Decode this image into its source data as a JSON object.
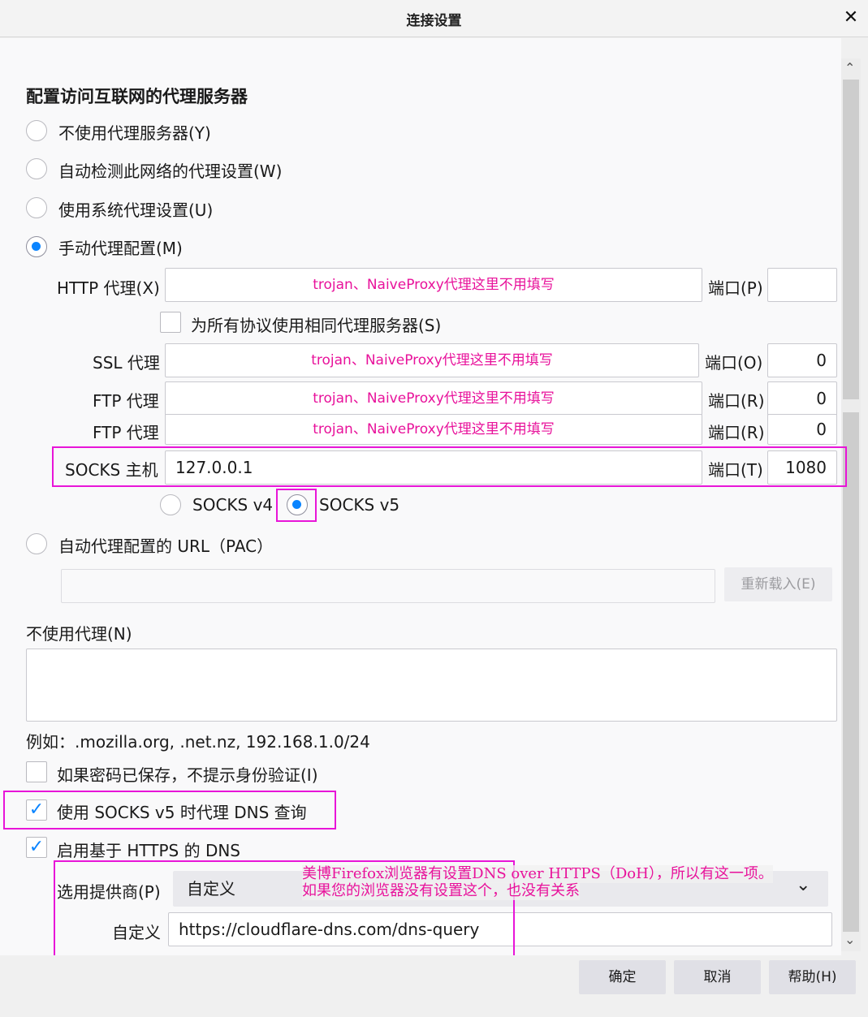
{
  "window": {
    "title": "连接设置",
    "close_glyph": "✕"
  },
  "heading": "配置访问互联网的代理服务器",
  "proxy_modes": [
    {
      "label": "不使用代理服务器(Y)",
      "checked": false
    },
    {
      "label": "自动检测此网络的代理设置(W)",
      "checked": false
    },
    {
      "label": "使用系统代理设置(U)",
      "checked": false
    },
    {
      "label": "手动代理配置(M)",
      "checked": true
    }
  ],
  "manual": {
    "http_label": "HTTP 代理(X)",
    "http_value": "trojan、NaiveProxy代理这里不用填写",
    "http_port_label": "端口(P)",
    "http_port_value": "",
    "same_proxy_label": "为所有协议使用相同代理服务器(S)",
    "ssl_label": "SSL 代理",
    "ssl_value": "trojan、NaiveProxy代理这里不用填写",
    "ssl_port_label": "端口(O)",
    "ssl_port_value": "0",
    "ftp1_label": "FTP 代理",
    "ftp1_value": "trojan、NaiveProxy代理这里不用填写",
    "ftp1_port_label": "端口(R)",
    "ftp1_port_value": "0",
    "ftp2_label": "FTP 代理",
    "ftp2_value": "trojan、NaiveProxy代理这里不用填写",
    "ftp2_port_label": "端口(R)",
    "ftp2_port_value": "0",
    "socks_label": "SOCKS 主机",
    "socks_value": "127.0.0.1",
    "socks_port_label": "端口(T)",
    "socks_port_value": "1080",
    "socks_v4_label": "SOCKS v4",
    "socks_v5_label": "SOCKS v5",
    "socks_version": "v5"
  },
  "pac": {
    "label": "自动代理配置的 URL（PAC）",
    "value": "",
    "reload_label": "重新载入(E)"
  },
  "no_proxy": {
    "label": "不使用代理(N)",
    "value": "",
    "example": "例如：.mozilla.org, .net.nz, 192.168.1.0/24"
  },
  "options": {
    "no_auth_prompt_label": "如果密码已保存，不提示身份验证(I)",
    "no_auth_prompt_checked": false,
    "socks_dns_label": "使用 SOCKS v5 时代理 DNS 查询",
    "socks_dns_checked": true,
    "doh_label": "启用基于 HTTPS 的 DNS",
    "doh_checked": true
  },
  "doh": {
    "provider_label": "选用提供商(P)",
    "provider_value": "自定义",
    "custom_label": "自定义",
    "custom_value": "https://cloudflare-dns.com/dns-query"
  },
  "annotation": {
    "line1": "美博Firefox浏览器有设置DNS over HTTPS（DoH），所以有这一项。",
    "line2": "如果您的浏览器没有设置这个，也没有关系"
  },
  "buttons": {
    "ok": "确定",
    "cancel": "取消",
    "help": "帮助(H)"
  },
  "icons": {
    "close": "close-icon",
    "checkmark": "✓",
    "chevron_down": "⌄",
    "scroll_up": "⌃",
    "scroll_down": "⌄"
  },
  "colors": {
    "accent": "#0a84ff",
    "highlight_box": "#e815d8",
    "hint_text": "#e8129b"
  }
}
